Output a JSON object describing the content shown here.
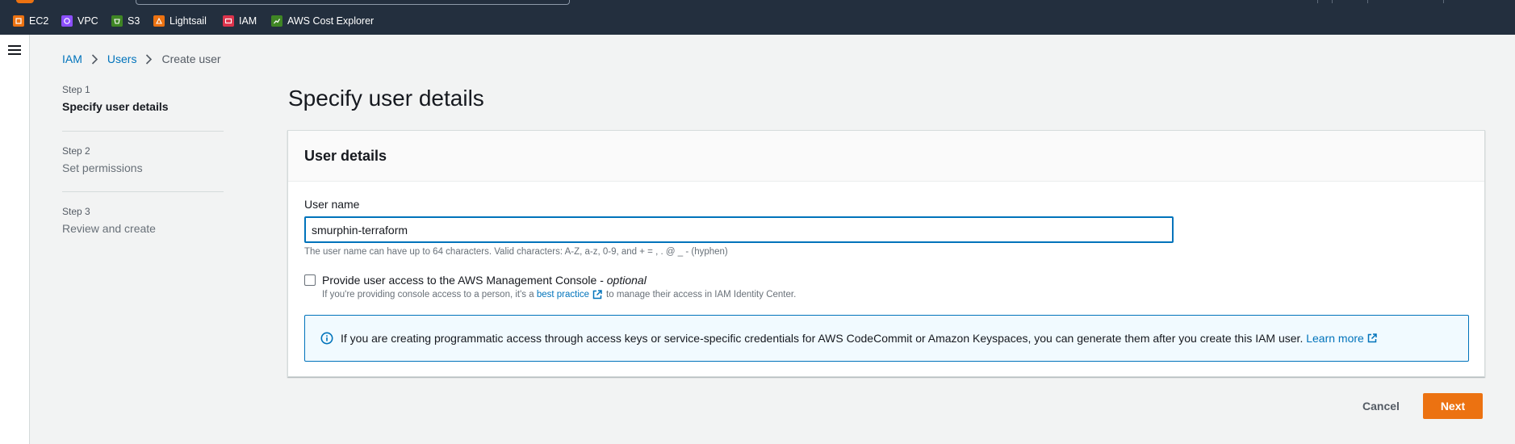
{
  "favorites": [
    {
      "label": "EC2",
      "icon": "ec2-service-icon",
      "color": "#ec7211"
    },
    {
      "label": "VPC",
      "icon": "vpc-service-icon",
      "color": "#8c4fff"
    },
    {
      "label": "S3",
      "icon": "s3-service-icon",
      "color": "#3f8624"
    },
    {
      "label": "Lightsail",
      "icon": "lightsail-service-icon",
      "color": "#ec7211"
    },
    {
      "label": "IAM",
      "icon": "iam-service-icon",
      "color": "#dd344c"
    },
    {
      "label": "AWS Cost Explorer",
      "icon": "cost-explorer-service-icon",
      "color": "#3f8624"
    }
  ],
  "breadcrumb": {
    "items": [
      "IAM",
      "Users",
      "Create user"
    ]
  },
  "steps": [
    {
      "number": "Step 1",
      "title": "Specify user details",
      "active": true
    },
    {
      "number": "Step 2",
      "title": "Set permissions",
      "active": false
    },
    {
      "number": "Step 3",
      "title": "Review and create",
      "active": false
    }
  ],
  "page": {
    "title": "Specify user details"
  },
  "card": {
    "title": "User details",
    "username_label": "User name",
    "username_value": "smurphin-terraform",
    "username_hint": "The user name can have up to 64 characters. Valid characters: A-Z, a-z, 0-9, and + = , . @ _ - (hyphen)",
    "console_access_label": "Provide user access to the AWS Management Console - ",
    "console_access_optional": "optional",
    "console_access_checked": false,
    "console_desc_before": "If you're providing console access to a person, it's a ",
    "console_desc_link": "best practice",
    "console_desc_after": "to manage their access in IAM Identity Center."
  },
  "alert": {
    "message": "If you are creating programmatic access through access keys or service-specific credentials for AWS CodeCommit or Amazon Keyspaces, you can generate them after you create this IAM user. ",
    "link": "Learn more"
  },
  "actions": {
    "cancel": "Cancel",
    "next": "Next"
  },
  "colors": {
    "topbar": "#232f3e",
    "link": "#0073bb",
    "primary": "#ec7211"
  }
}
